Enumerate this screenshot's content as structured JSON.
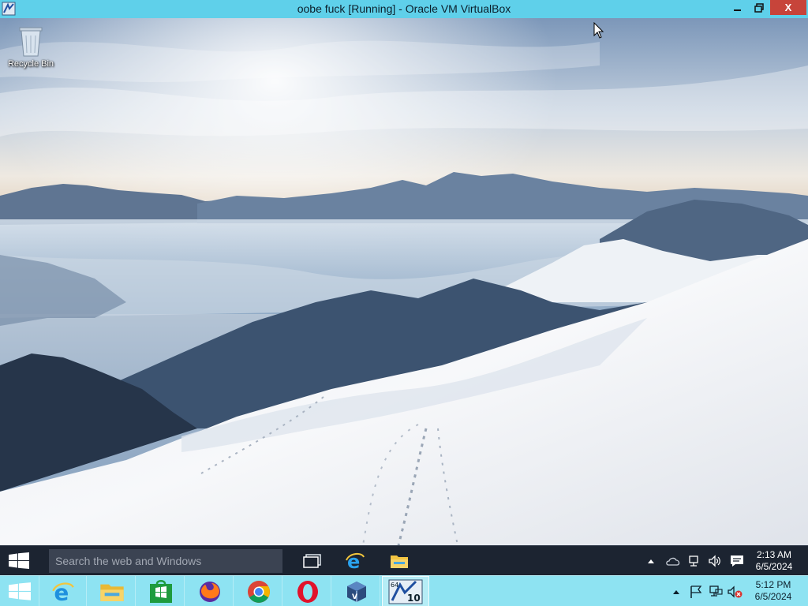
{
  "window": {
    "title": "oobe fuck [Running] - Oracle VM VirtualBox",
    "app_icon": "virtualbox-icon",
    "controls": [
      "minimize-icon",
      "restore-icon",
      "close-icon"
    ],
    "close_glyph": "X"
  },
  "desktop": {
    "icons": [
      {
        "label": "Recycle Bin",
        "icon": "recycle-bin-icon"
      }
    ],
    "wallpaper": "snowy-mountain-landscape"
  },
  "guest_taskbar": {
    "search_placeholder": "Search the web and Windows",
    "pinned": [
      "task-view-icon",
      "internet-explorer-icon",
      "file-explorer-icon"
    ],
    "tray_icons": [
      "show-hidden-icons-icon",
      "onedrive-icon",
      "network-icon",
      "volume-icon",
      "action-center-icon"
    ],
    "clock_time": "2:13 AM",
    "clock_date": "6/5/2024",
    "background": "#1c2431"
  },
  "host_taskbar": {
    "apps": [
      {
        "name": "start",
        "icon": "windows-logo-icon"
      },
      {
        "name": "internet-explorer",
        "icon": "internet-explorer-icon"
      },
      {
        "name": "file-explorer",
        "icon": "file-explorer-icon"
      },
      {
        "name": "store",
        "icon": "windows-store-icon"
      },
      {
        "name": "firefox",
        "icon": "firefox-icon"
      },
      {
        "name": "chrome",
        "icon": "chrome-icon"
      },
      {
        "name": "opera",
        "icon": "opera-icon"
      },
      {
        "name": "virtualbox",
        "icon": "virtualbox-icon"
      },
      {
        "name": "win10-vm",
        "icon": "windows10-vm-icon",
        "active": true,
        "badge": "10",
        "badge_top": "64"
      }
    ],
    "tray_icons": [
      "show-hidden-icons-icon",
      "action-center-flag-icon",
      "network-icon",
      "volume-muted-icon"
    ],
    "clock_time": "5:12 PM",
    "clock_date": "6/5/2024",
    "background": "#8ee3f2"
  }
}
